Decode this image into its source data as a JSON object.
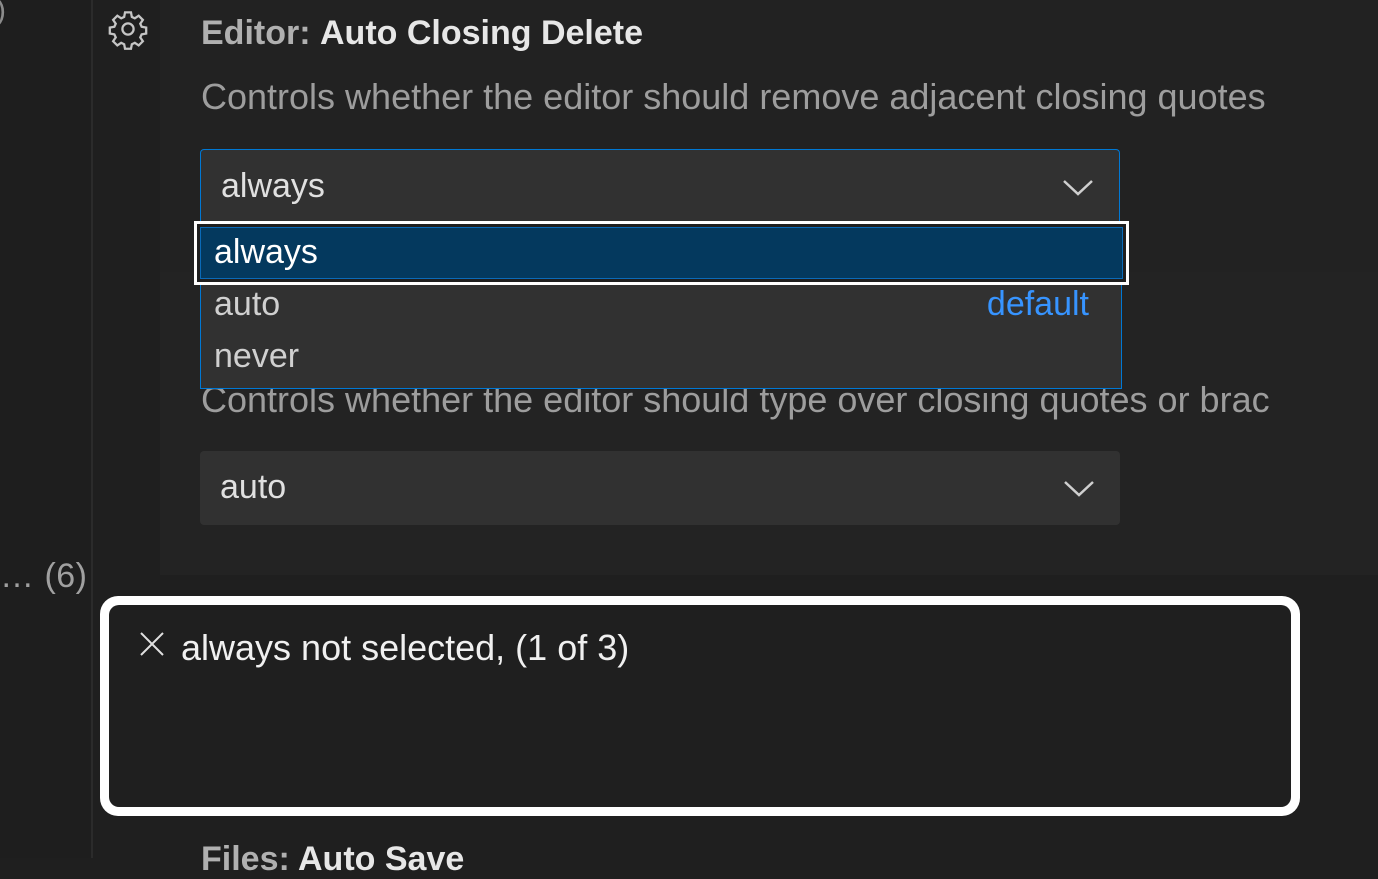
{
  "left_panel": {
    "top_glyph": ")",
    "count_text": "… (6)"
  },
  "setting1": {
    "category": "Editor:",
    "name": "Auto Closing Delete",
    "description": "Controls whether the editor should remove adjacent closing quotes",
    "selected_value": "always",
    "options": [
      {
        "label": "always",
        "tag": ""
      },
      {
        "label": "auto",
        "tag": "default"
      },
      {
        "label": "never",
        "tag": ""
      }
    ]
  },
  "setting2": {
    "description": "Controls whether the editor should type over closing quotes or brac",
    "selected_value": "auto"
  },
  "toast": {
    "message": "always not selected, (1 of 3)"
  },
  "next_setting": {
    "category": "Files:",
    "name": "Auto Save"
  },
  "icons": {
    "gear": "gear-icon",
    "chevron": "chevron-down-icon",
    "close": "close-icon"
  },
  "colors": {
    "accent": "#0078d4",
    "highlight": "#04395e",
    "link": "#3794ff"
  }
}
